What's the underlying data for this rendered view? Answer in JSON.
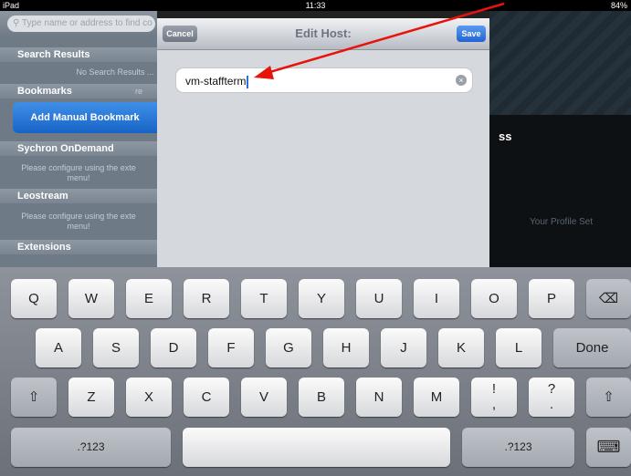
{
  "status": {
    "carrier": "iPad",
    "time": "11:33",
    "battery": "84%"
  },
  "sidebar": {
    "search_placeholder": "Type name or address to find co",
    "search_results_header": "Search Results",
    "search_results_empty": "No Search Results ...",
    "bookmarks_header": "Bookmarks",
    "bookmarks_right": "re",
    "add_bookmark_label": "Add Manual Bookmark",
    "synchron_header": "Sychron OnDemand",
    "synchron_note_1": "Please configure using the exte",
    "synchron_note_2": "menu!",
    "leostream_header": "Leostream",
    "leostream_note_1": "Please configure using the exte",
    "leostream_note_2": "menu!",
    "extensions_header": "Extensions"
  },
  "background": {
    "ss_text": "ss",
    "faint_text": "Your Profile Set"
  },
  "modal": {
    "title": "Edit Host:",
    "cancel_label": "Cancel",
    "save_label": "Save",
    "host_value": "vm-staffterm",
    "clear_icon": "×"
  },
  "keyboard": {
    "row1": [
      "Q",
      "W",
      "E",
      "R",
      "T",
      "Y",
      "U",
      "I",
      "O",
      "P"
    ],
    "row2": [
      "A",
      "S",
      "D",
      "F",
      "G",
      "H",
      "J",
      "K",
      "L"
    ],
    "row3": [
      "Z",
      "X",
      "C",
      "V",
      "B",
      "N",
      "M"
    ],
    "backspace": "⌫",
    "done": "Done",
    "shift": "⇧",
    "excl_top": "!",
    "excl_bottom": ",",
    "q_top": "?",
    "q_bottom": ".",
    "numbers_left": ".?123",
    "numbers_right": ".?123",
    "hide_keyboard": "⌨"
  },
  "colors": {
    "accent_blue": "#1864c6",
    "annotation_arrow": "#e8140c"
  }
}
